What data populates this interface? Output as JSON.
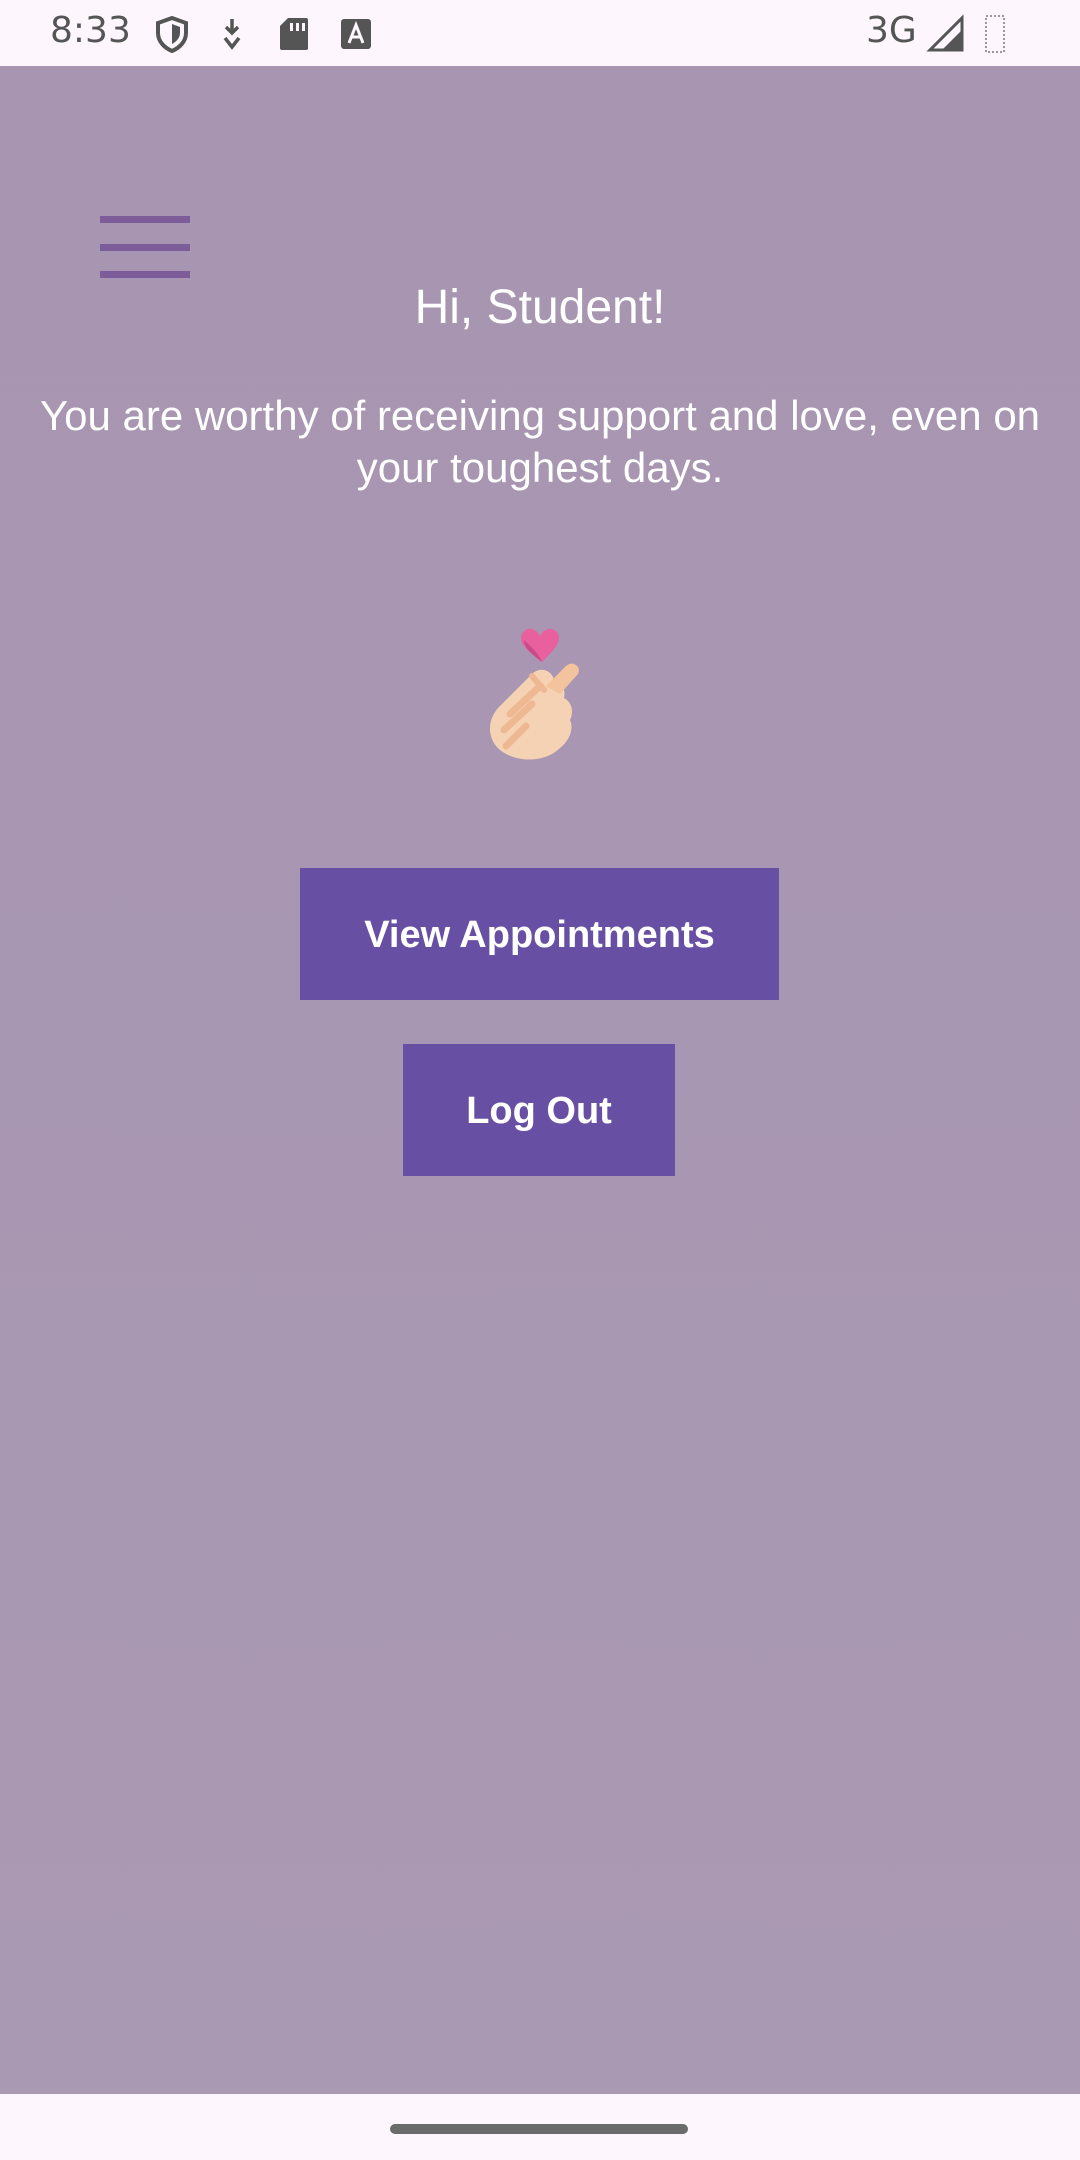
{
  "status_bar": {
    "time": "8:33",
    "network": "3G",
    "icons": [
      "shield-icon",
      "download-icon",
      "sd-card-icon",
      "font-a-icon",
      "signal-icon",
      "battery-icon"
    ]
  },
  "main": {
    "menu_icon": "hamburger-menu-icon",
    "greeting": "Hi, Student!",
    "affirmation": "You are worthy of receiving support and love, even on your toughest days.",
    "emoji": "finger-heart-icon",
    "buttons": {
      "appointments": "View Appointments",
      "logout": "Log Out"
    }
  },
  "colors": {
    "background": "#a795b1",
    "button": "#6750a4",
    "menu_icon": "#7c5d9a",
    "text": "#ffffff"
  }
}
